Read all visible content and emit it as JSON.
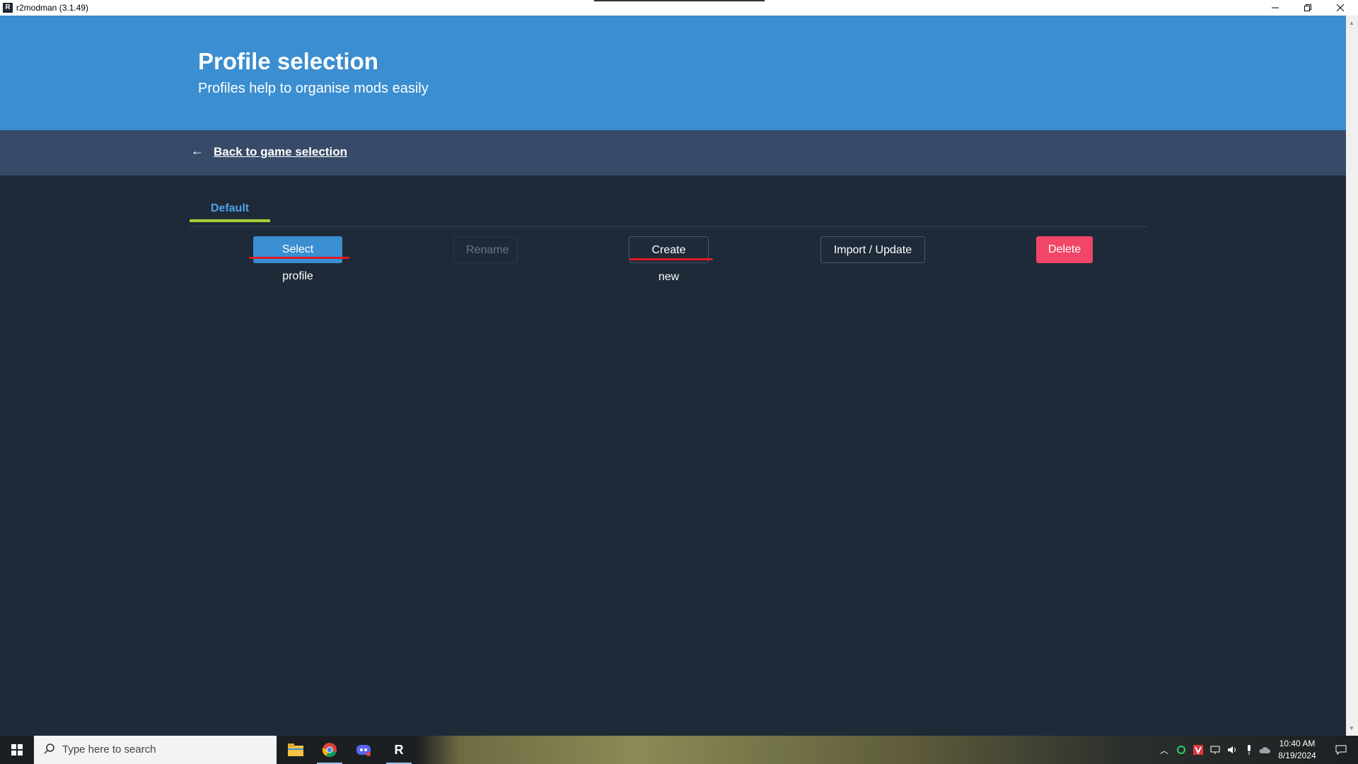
{
  "window": {
    "app_icon": "R",
    "title": "r2modman (3.1.49)"
  },
  "header": {
    "title": "Profile selection",
    "subtitle": "Profiles help to organise mods easily"
  },
  "nav": {
    "back_arrow": "←",
    "back_label": "Back to game selection"
  },
  "tabs": [
    {
      "label": "Default",
      "active": true
    }
  ],
  "actions": {
    "select_profile": "Select profile",
    "rename": "Rename",
    "create_new": "Create new",
    "import_update": "Import / Update",
    "delete": "Delete"
  },
  "colors": {
    "header_bg": "#3b8ed0",
    "nav_bg": "#374a67",
    "main_bg": "#1e2a38",
    "primary_button": "#3b8ed0",
    "danger_button": "#f14668",
    "tab_accent": "#a6d135",
    "annotation_red": "#e01b24"
  },
  "taskbar": {
    "search_placeholder": "Type here to search",
    "apps": [
      "file-explorer-icon",
      "chrome-icon",
      "discord-icon",
      "r2modman-icon"
    ],
    "r2_label": "R",
    "time": "10:40 AM",
    "date": "8/19/2024"
  }
}
